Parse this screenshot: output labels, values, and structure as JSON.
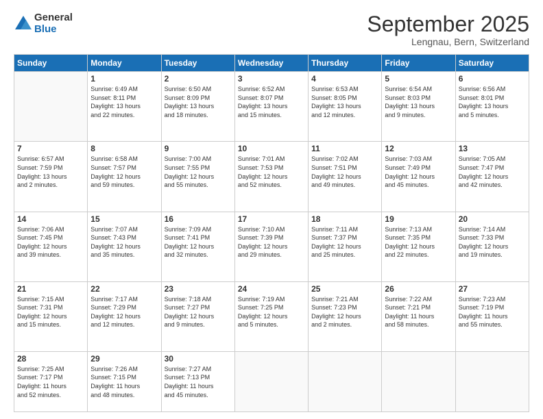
{
  "logo": {
    "general": "General",
    "blue": "Blue"
  },
  "header": {
    "month": "September 2025",
    "location": "Lengnau, Bern, Switzerland"
  },
  "weekdays": [
    "Sunday",
    "Monday",
    "Tuesday",
    "Wednesday",
    "Thursday",
    "Friday",
    "Saturday"
  ],
  "weeks": [
    [
      {
        "day": "",
        "info": ""
      },
      {
        "day": "1",
        "info": "Sunrise: 6:49 AM\nSunset: 8:11 PM\nDaylight: 13 hours\nand 22 minutes."
      },
      {
        "day": "2",
        "info": "Sunrise: 6:50 AM\nSunset: 8:09 PM\nDaylight: 13 hours\nand 18 minutes."
      },
      {
        "day": "3",
        "info": "Sunrise: 6:52 AM\nSunset: 8:07 PM\nDaylight: 13 hours\nand 15 minutes."
      },
      {
        "day": "4",
        "info": "Sunrise: 6:53 AM\nSunset: 8:05 PM\nDaylight: 13 hours\nand 12 minutes."
      },
      {
        "day": "5",
        "info": "Sunrise: 6:54 AM\nSunset: 8:03 PM\nDaylight: 13 hours\nand 9 minutes."
      },
      {
        "day": "6",
        "info": "Sunrise: 6:56 AM\nSunset: 8:01 PM\nDaylight: 13 hours\nand 5 minutes."
      }
    ],
    [
      {
        "day": "7",
        "info": "Sunrise: 6:57 AM\nSunset: 7:59 PM\nDaylight: 13 hours\nand 2 minutes."
      },
      {
        "day": "8",
        "info": "Sunrise: 6:58 AM\nSunset: 7:57 PM\nDaylight: 12 hours\nand 59 minutes."
      },
      {
        "day": "9",
        "info": "Sunrise: 7:00 AM\nSunset: 7:55 PM\nDaylight: 12 hours\nand 55 minutes."
      },
      {
        "day": "10",
        "info": "Sunrise: 7:01 AM\nSunset: 7:53 PM\nDaylight: 12 hours\nand 52 minutes."
      },
      {
        "day": "11",
        "info": "Sunrise: 7:02 AM\nSunset: 7:51 PM\nDaylight: 12 hours\nand 49 minutes."
      },
      {
        "day": "12",
        "info": "Sunrise: 7:03 AM\nSunset: 7:49 PM\nDaylight: 12 hours\nand 45 minutes."
      },
      {
        "day": "13",
        "info": "Sunrise: 7:05 AM\nSunset: 7:47 PM\nDaylight: 12 hours\nand 42 minutes."
      }
    ],
    [
      {
        "day": "14",
        "info": "Sunrise: 7:06 AM\nSunset: 7:45 PM\nDaylight: 12 hours\nand 39 minutes."
      },
      {
        "day": "15",
        "info": "Sunrise: 7:07 AM\nSunset: 7:43 PM\nDaylight: 12 hours\nand 35 minutes."
      },
      {
        "day": "16",
        "info": "Sunrise: 7:09 AM\nSunset: 7:41 PM\nDaylight: 12 hours\nand 32 minutes."
      },
      {
        "day": "17",
        "info": "Sunrise: 7:10 AM\nSunset: 7:39 PM\nDaylight: 12 hours\nand 29 minutes."
      },
      {
        "day": "18",
        "info": "Sunrise: 7:11 AM\nSunset: 7:37 PM\nDaylight: 12 hours\nand 25 minutes."
      },
      {
        "day": "19",
        "info": "Sunrise: 7:13 AM\nSunset: 7:35 PM\nDaylight: 12 hours\nand 22 minutes."
      },
      {
        "day": "20",
        "info": "Sunrise: 7:14 AM\nSunset: 7:33 PM\nDaylight: 12 hours\nand 19 minutes."
      }
    ],
    [
      {
        "day": "21",
        "info": "Sunrise: 7:15 AM\nSunset: 7:31 PM\nDaylight: 12 hours\nand 15 minutes."
      },
      {
        "day": "22",
        "info": "Sunrise: 7:17 AM\nSunset: 7:29 PM\nDaylight: 12 hours\nand 12 minutes."
      },
      {
        "day": "23",
        "info": "Sunrise: 7:18 AM\nSunset: 7:27 PM\nDaylight: 12 hours\nand 9 minutes."
      },
      {
        "day": "24",
        "info": "Sunrise: 7:19 AM\nSunset: 7:25 PM\nDaylight: 12 hours\nand 5 minutes."
      },
      {
        "day": "25",
        "info": "Sunrise: 7:21 AM\nSunset: 7:23 PM\nDaylight: 12 hours\nand 2 minutes."
      },
      {
        "day": "26",
        "info": "Sunrise: 7:22 AM\nSunset: 7:21 PM\nDaylight: 11 hours\nand 58 minutes."
      },
      {
        "day": "27",
        "info": "Sunrise: 7:23 AM\nSunset: 7:19 PM\nDaylight: 11 hours\nand 55 minutes."
      }
    ],
    [
      {
        "day": "28",
        "info": "Sunrise: 7:25 AM\nSunset: 7:17 PM\nDaylight: 11 hours\nand 52 minutes."
      },
      {
        "day": "29",
        "info": "Sunrise: 7:26 AM\nSunset: 7:15 PM\nDaylight: 11 hours\nand 48 minutes."
      },
      {
        "day": "30",
        "info": "Sunrise: 7:27 AM\nSunset: 7:13 PM\nDaylight: 11 hours\nand 45 minutes."
      },
      {
        "day": "",
        "info": ""
      },
      {
        "day": "",
        "info": ""
      },
      {
        "day": "",
        "info": ""
      },
      {
        "day": "",
        "info": ""
      }
    ]
  ]
}
